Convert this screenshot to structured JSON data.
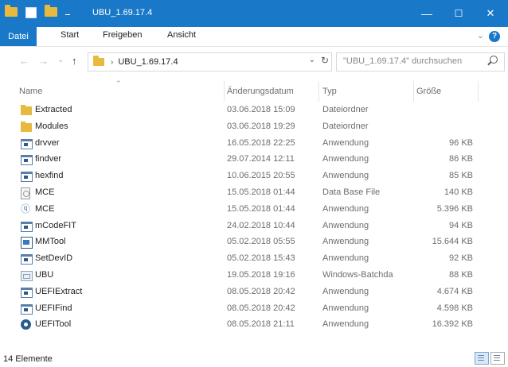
{
  "window": {
    "title": "UBU_1.69.17.4",
    "minimize": "—",
    "maximize": "☐",
    "close": "✕",
    "accent_color": "#1979c8"
  },
  "ribbon": {
    "tabs": [
      "Datei",
      "Start",
      "Freigeben",
      "Ansicht"
    ],
    "expand": "⌄",
    "help": "?"
  },
  "address": {
    "back": "←",
    "forward": "→",
    "up": "↑",
    "path_separator": "›",
    "path": "UBU_1.69.17.4",
    "dropdown": "⌄",
    "refresh": "↻"
  },
  "search": {
    "placeholder": "\"UBU_1.69.17.4\" durchsuchen"
  },
  "columns": {
    "name": "Name",
    "date": "Änderungsdatum",
    "type": "Typ",
    "size": "Größe",
    "sort_indicator": "⌃"
  },
  "files": [
    {
      "icon": "folder-icon",
      "name": "Extracted",
      "date": "03.06.2018 15:09",
      "type": "Dateiordner",
      "size": ""
    },
    {
      "icon": "folder-icon",
      "name": "Modules",
      "date": "03.06.2018 19:29",
      "type": "Dateiordner",
      "size": ""
    },
    {
      "icon": "application-icon",
      "name": "drvver",
      "date": "16.05.2018 22:25",
      "type": "Anwendung",
      "size": "96 KB"
    },
    {
      "icon": "application-icon",
      "name": "findver",
      "date": "29.07.2014 12:11",
      "type": "Anwendung",
      "size": "86 KB"
    },
    {
      "icon": "application-icon",
      "name": "hexfind",
      "date": "10.06.2015 20:55",
      "type": "Anwendung",
      "size": "85 KB"
    },
    {
      "icon": "database-file-icon",
      "name": "MCE",
      "date": "15.05.2018 01:44",
      "type": "Data Base File",
      "size": "140 KB"
    },
    {
      "icon": "mce-application-icon",
      "name": "MCE",
      "date": "15.05.2018 01:44",
      "type": "Anwendung",
      "size": "5.396 KB"
    },
    {
      "icon": "application-icon",
      "name": "mCodeFIT",
      "date": "24.02.2018 10:44",
      "type": "Anwendung",
      "size": "94 KB"
    },
    {
      "icon": "mmtool-icon",
      "name": "MMTool",
      "date": "05.02.2018 05:55",
      "type": "Anwendung",
      "size": "15.644 KB"
    },
    {
      "icon": "application-icon",
      "name": "SetDevID",
      "date": "05.02.2018 15:43",
      "type": "Anwendung",
      "size": "92 KB"
    },
    {
      "icon": "batch-file-icon",
      "name": "UBU",
      "date": "19.05.2018 19:16",
      "type": "Windows-Batchda",
      "size": "88 KB"
    },
    {
      "icon": "application-icon",
      "name": "UEFIExtract",
      "date": "08.05.2018 20:42",
      "type": "Anwendung",
      "size": "4.674 KB"
    },
    {
      "icon": "application-icon",
      "name": "UEFIFind",
      "date": "08.05.2018 20:42",
      "type": "Anwendung",
      "size": "4.598 KB"
    },
    {
      "icon": "gear-icon",
      "name": "UEFITool",
      "date": "08.05.2018 21:11",
      "type": "Anwendung",
      "size": "16.392 KB"
    }
  ],
  "status": {
    "count": "14 Elemente"
  }
}
